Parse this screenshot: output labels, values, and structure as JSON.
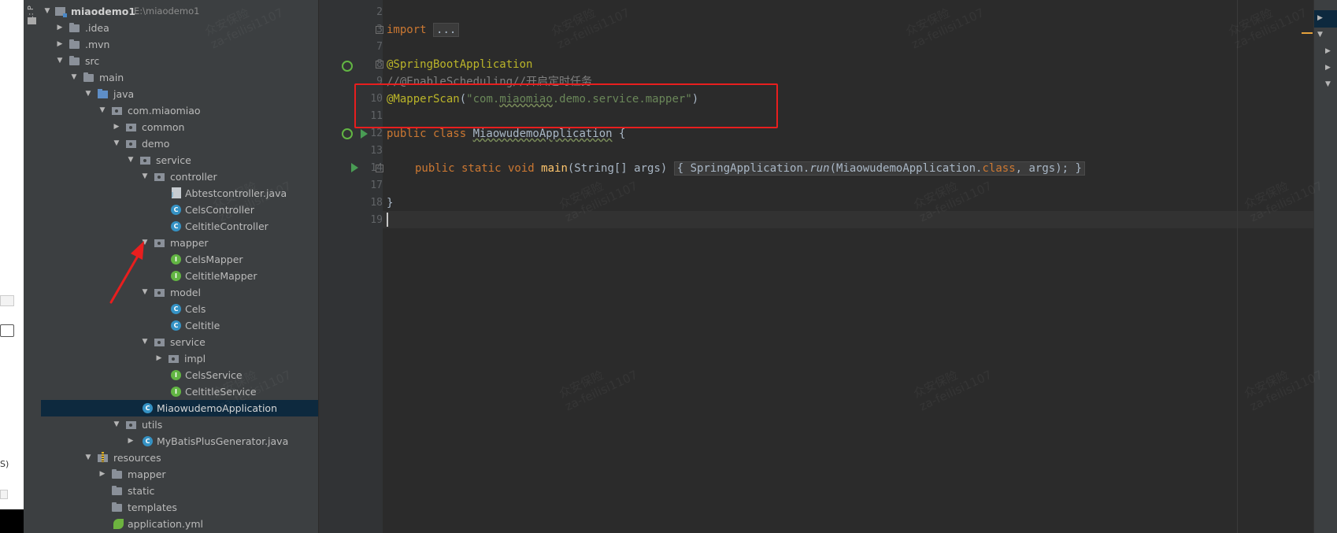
{
  "tool_window": {
    "tab_label": "1: P"
  },
  "outer_strip": {
    "text": "S)"
  },
  "project_tree": {
    "root": {
      "name": "miaodemo1",
      "path": "E:\\miaodemo1"
    },
    "items": [
      {
        "label": ".idea"
      },
      {
        "label": ".mvn"
      },
      {
        "label": "src"
      },
      {
        "label": "main"
      },
      {
        "label": "java"
      },
      {
        "label": "com.miaomiao"
      },
      {
        "label": "common"
      },
      {
        "label": "demo"
      },
      {
        "label": "service"
      },
      {
        "label": "controller"
      },
      {
        "label": "Abtestcontroller.java"
      },
      {
        "label": "CelsController"
      },
      {
        "label": "CeltitleController"
      },
      {
        "label": "mapper"
      },
      {
        "label": "CelsMapper"
      },
      {
        "label": "CeltitleMapper"
      },
      {
        "label": "model"
      },
      {
        "label": "Cels"
      },
      {
        "label": "Celtitle"
      },
      {
        "label": "service"
      },
      {
        "label": "impl"
      },
      {
        "label": "CelsService"
      },
      {
        "label": "CeltitleService"
      },
      {
        "label": "MiaowudemoApplication"
      },
      {
        "label": "utils"
      },
      {
        "label": "MyBatisPlusGenerator.java"
      },
      {
        "label": "resources"
      },
      {
        "label": "mapper"
      },
      {
        "label": "static"
      },
      {
        "label": "templates"
      },
      {
        "label": "application.yml"
      }
    ]
  },
  "editor": {
    "line_numbers": [
      "2",
      "3",
      "7",
      "8",
      "9",
      "10",
      "11",
      "12",
      "13",
      "14",
      "17",
      "18",
      "19"
    ],
    "code": {
      "l3_kw": "import",
      "l3_fold": "...",
      "l8_ann": "@SpringBootApplication",
      "l9_comment": "//@EnableScheduling//开启定时任务",
      "l10_ann": "@MapperScan",
      "l10_open": "(",
      "l10_str_a": "\"com.",
      "l10_str_b": "miaomiao",
      "l10_str_c": ".demo.service.mapper\"",
      "l10_close": ")",
      "l12_kw": "public class ",
      "l12_name": "MiaowudemoApplication",
      "l12_rest": " {",
      "l14_kw": "public static void ",
      "l14_method": "main",
      "l14_params": "(String[] args) ",
      "l14_fold_a": "{ SpringApplication.",
      "l14_run": "run",
      "l14_fold_b": "(MiaowudemoApplication.",
      "l14_cls": "class",
      "l14_fold_c": ", args); }",
      "l18": "}"
    }
  },
  "watermarks": [
    {
      "line1": "众安保险",
      "line2": "za-feilisi1107"
    }
  ],
  "colors": {
    "highlight_box": "#e81e1e",
    "annotation": "#bbb529",
    "keyword": "#cc7832",
    "string": "#6a8759"
  }
}
